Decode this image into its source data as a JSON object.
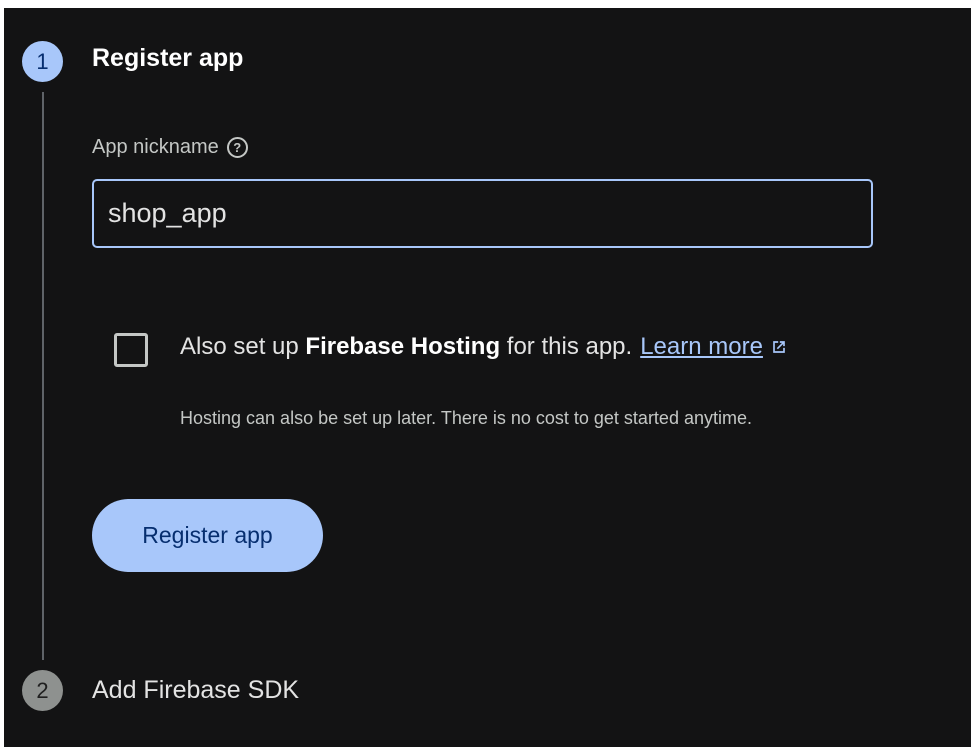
{
  "steps": [
    {
      "number": "1",
      "title": "Register app",
      "state": "active"
    },
    {
      "number": "2",
      "title": "Add Firebase SDK",
      "state": "inactive"
    }
  ],
  "form": {
    "nickname_label": "App nickname",
    "help_icon": "help-circle-icon",
    "nickname_value": "shop_app",
    "hosting_prefix": "Also set up ",
    "hosting_bold": "Firebase Hosting",
    "hosting_suffix": " for this app.",
    "learn_more": "Learn more",
    "external_icon": "open-in-new-icon",
    "hosting_hint": "Hosting can also be set up later. There is no cost to get started anytime.",
    "hosting_checked": false,
    "register_button": "Register app"
  },
  "colors": {
    "background": "#131314",
    "accent": "#a8c7fa",
    "accent_text": "#062e6f",
    "inactive_step": "#8e918f"
  }
}
